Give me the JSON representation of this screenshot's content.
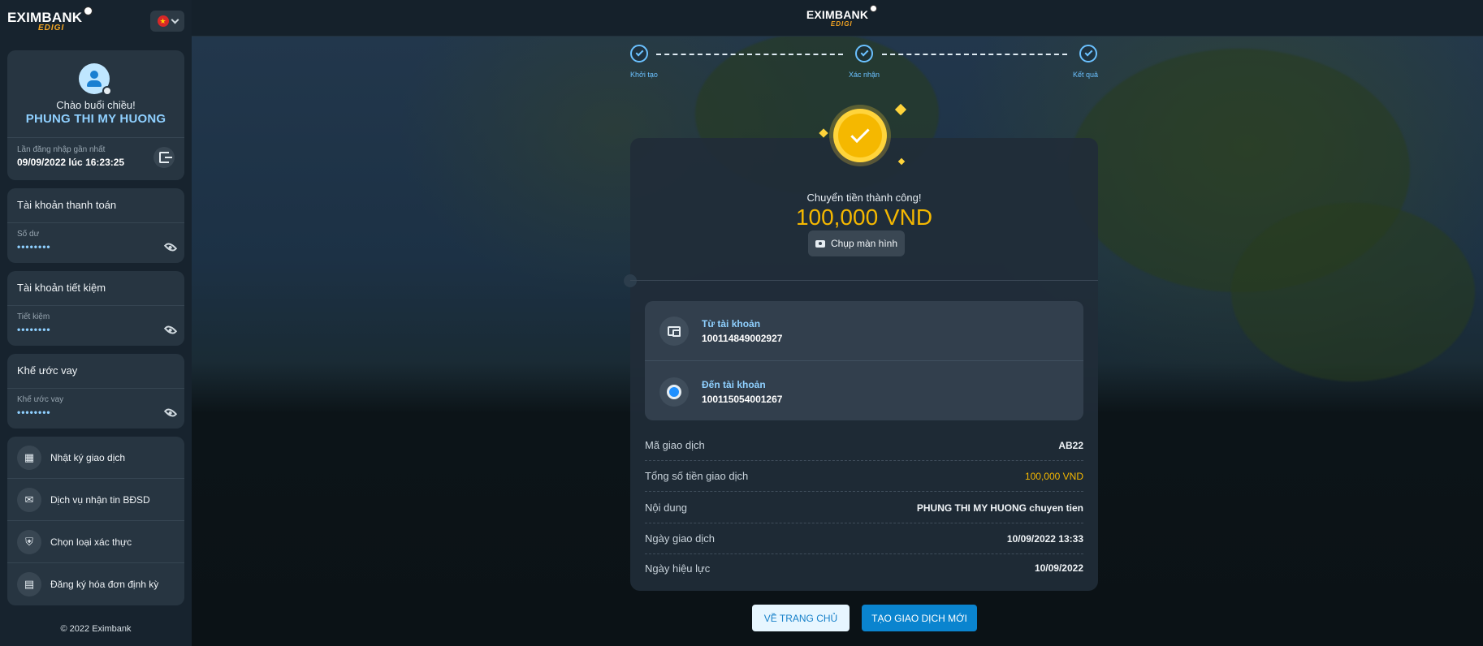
{
  "brand": {
    "name": "EXIMBANK",
    "sub": "EDIGI"
  },
  "sidebar": {
    "language_flag": "★",
    "greeting": "Chào buổi chiều!",
    "user_name": "PHUNG THI MY HUONG",
    "last_login_label": "Lần đăng nhập gần nhất",
    "last_login_value": "09/09/2022 lúc 16:23:25",
    "accounts": [
      {
        "title": "Tài khoản thanh toán",
        "label": "Số dư",
        "value": "••••••••"
      },
      {
        "title": "Tài khoản tiết kiệm",
        "label": "Tiết kiệm",
        "value": "••••••••"
      },
      {
        "title": "Khế ước vay",
        "label": "Khế ước vay",
        "value": "••••••••"
      }
    ],
    "menu": [
      {
        "label": "Nhật ký giao dịch",
        "icon": "calendar-icon",
        "glyph": "▦"
      },
      {
        "label": "Dịch vụ nhận tin BĐSD",
        "icon": "message-icon",
        "glyph": "✉"
      },
      {
        "label": "Chọn loại xác thực",
        "icon": "shield-icon",
        "glyph": "⛨"
      },
      {
        "label": "Đăng ký hóa đơn định kỳ",
        "icon": "bill-icon",
        "glyph": "▤"
      }
    ],
    "copyright": "© 2022 Eximbank"
  },
  "stepper": {
    "steps": [
      {
        "label": "Khởi tạo"
      },
      {
        "label": "Xác nhận"
      },
      {
        "label": "Kết quả"
      }
    ]
  },
  "receipt": {
    "success_text": "Chuyển tiền thành công!",
    "amount": "100,000 VND",
    "screenshot_label": "Chụp màn hình",
    "from_label": "Từ tài khoản",
    "from_account": "100114849002927",
    "to_label": "Đến tài khoản",
    "to_account": "100115054001267",
    "details": [
      {
        "key": "Mã giao dịch",
        "value": "AB22"
      },
      {
        "key": "Tổng số tiền giao dịch",
        "value": "100,000 VND"
      },
      {
        "key": "Nội dung",
        "value": "PHUNG THI MY HUONG chuyen tien"
      },
      {
        "key": "Ngày giao dịch",
        "value": "10/09/2022 13:33"
      },
      {
        "key": "Ngày hiệu lực",
        "value": "10/09/2022"
      }
    ]
  },
  "actions": {
    "home_label": "VỀ TRANG CHỦ",
    "new_label": "TẠO GIAO DỊCH MỚI"
  },
  "colors": {
    "accent": "#0a84cf",
    "gold": "#f5b800",
    "link": "#8fd0ff"
  }
}
